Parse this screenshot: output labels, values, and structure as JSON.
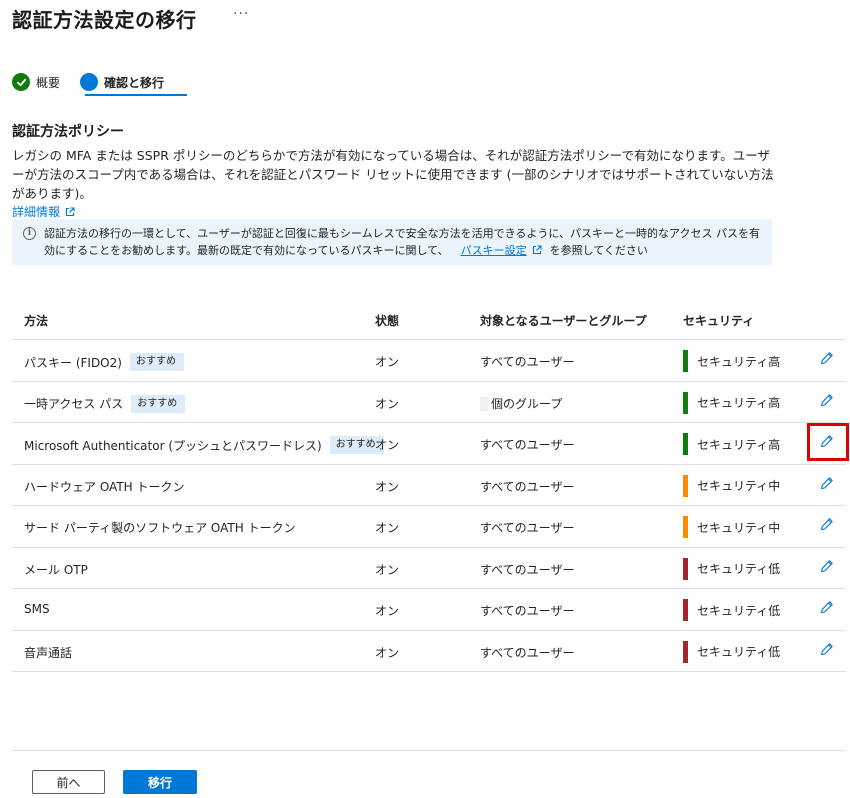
{
  "page": {
    "title": "認証方法設定の移行",
    "more_label": "···"
  },
  "steps": [
    {
      "label": "概要",
      "state": "done"
    },
    {
      "label": "確認と移行",
      "state": "current"
    }
  ],
  "policy": {
    "title": "認証方法ポリシー",
    "description": "レガシの MFA または SSPR ポリシーのどちらかで方法が有効になっている場合は、それが認証方法ポリシーで有効になります。ユーザーが方法のスコープ内である場合は、それを認証とパスワード リセットに使用できます (一部のシナリオではサポートされていない方法があります)。",
    "learn_more": "詳細情報"
  },
  "info": {
    "text_before": "認証方法の移行の一環として、ユーザーが認証と回復に最もシームレスで安全な方法を活用できるように、パスキーと一時的なアクセス パスを有効にすることをお勧めします。最新の既定で有効になっているパスキーに関して、",
    "link": "パスキー設定",
    "text_after": "を参照してください"
  },
  "table": {
    "headers": {
      "method": "方法",
      "state": "状態",
      "target": "対象となるユーザーとグループ",
      "security": "セキュリティ"
    },
    "rows": [
      {
        "method": "パスキー (FIDO2)",
        "badge": "おすすめ",
        "state": "オン",
        "target": "すべてのユーザー",
        "security": "セキュリティ高",
        "level": "high"
      },
      {
        "method": "一時アクセス パス",
        "badge": "おすすめ",
        "state": "オン",
        "target": "個のグループ",
        "security": "セキュリティ高",
        "level": "high"
      },
      {
        "method": "Microsoft Authenticator (プッシュとパスワードレス)",
        "badge": "おすすめ",
        "state": "オン",
        "target": "すべてのユーザー",
        "security": "セキュリティ高",
        "level": "high"
      },
      {
        "method": "ハードウェア OATH トークン",
        "badge": "",
        "state": "オン",
        "target": "すべてのユーザー",
        "security": "セキュリティ中",
        "level": "medium"
      },
      {
        "method": "サード パーティ製のソフトウェア OATH トークン",
        "badge": "",
        "state": "オン",
        "target": "すべてのユーザー",
        "security": "セキュリティ中",
        "level": "medium"
      },
      {
        "method": "メール OTP",
        "badge": "",
        "state": "オン",
        "target": "すべてのユーザー",
        "security": "セキュリティ低",
        "level": "low"
      },
      {
        "method": "SMS",
        "badge": "",
        "state": "オン",
        "target": "すべてのユーザー",
        "security": "セキュリティ低",
        "level": "low"
      },
      {
        "method": "音声通話",
        "badge": "",
        "state": "オン",
        "target": "すべてのユーザー",
        "security": "セキュリティ低",
        "level": "low"
      }
    ]
  },
  "colors": {
    "high": "#107c10",
    "medium": "#ff8c00",
    "low": "#a4262c",
    "accent": "#0078d4"
  },
  "footer": {
    "prev_label": "前へ",
    "next_label": "移行"
  }
}
